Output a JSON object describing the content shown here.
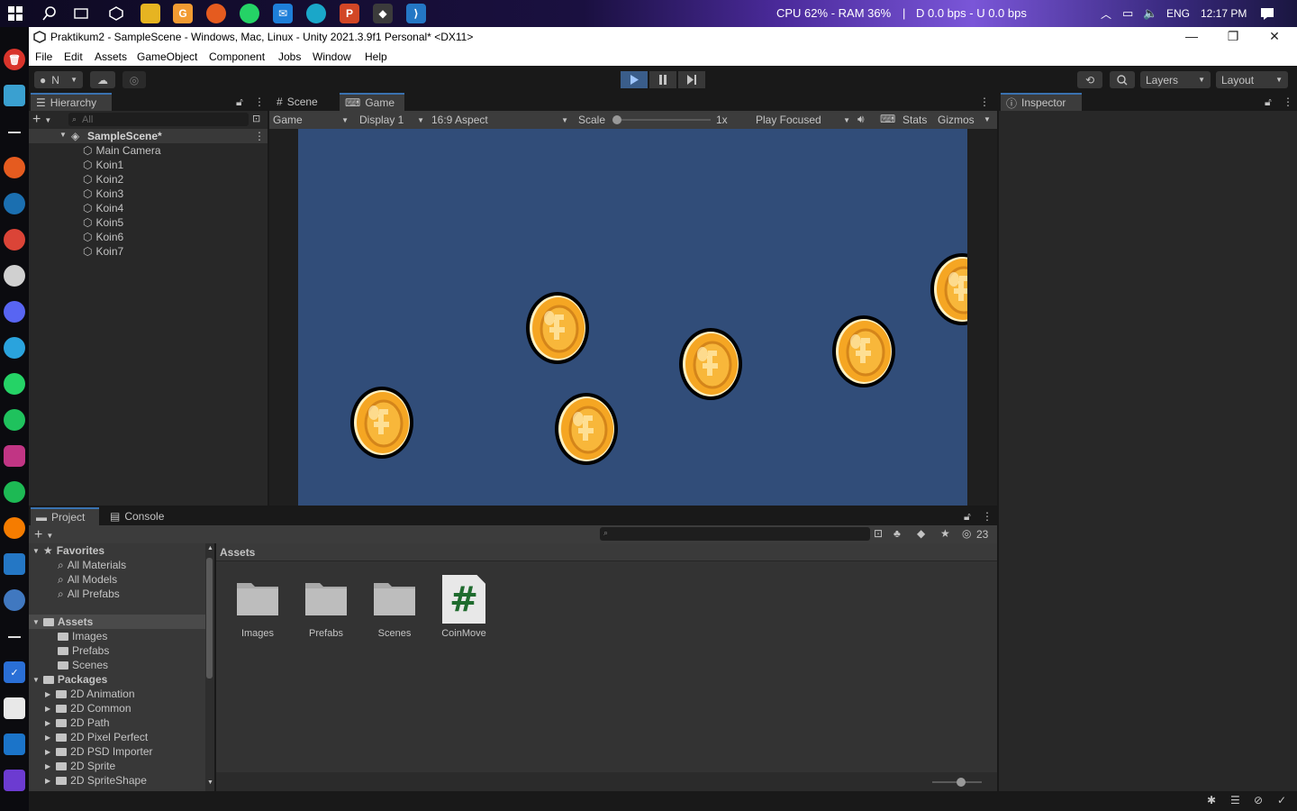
{
  "taskbar": {
    "stats": "CPU 62% - RAM 36%",
    "separator": "|",
    "network": "D 0.0 bps - U 0.0 bps",
    "lang": "ENG",
    "time": "12:17 PM"
  },
  "window": {
    "title": "Praktikum2 - SampleScene - Windows, Mac, Linux - Unity 2021.3.9f1 Personal* <DX11>",
    "minimize": "—",
    "maximize": "❐",
    "close": "✕"
  },
  "menu": [
    "File",
    "Edit",
    "Assets",
    "GameObject",
    "Component",
    "Jobs",
    "Window",
    "Help"
  ],
  "toolbar": {
    "account": "N",
    "layers": "Layers",
    "layout": "Layout"
  },
  "hierarchy": {
    "tab": "Hierarchy",
    "search_placeholder": "All",
    "scene": "SampleScene*",
    "items": [
      "Main Camera",
      "Koin1",
      "Koin2",
      "Koin3",
      "Koin4",
      "Koin5",
      "Koin6",
      "Koin7"
    ]
  },
  "sceneTabs": {
    "scene": "Scene",
    "game": "Game"
  },
  "gameBar": {
    "mode": "Game",
    "display": "Display 1",
    "aspect": "16:9 Aspect",
    "scale_label": "Scale",
    "scale_value": "1x",
    "play_mode": "Play Focused",
    "stats": "Stats",
    "gizmos": "Gizmos"
  },
  "inspector": {
    "tab": "Inspector"
  },
  "project": {
    "tab_project": "Project",
    "tab_console": "Console",
    "hidden_count": "23",
    "breadcrumb": "Assets",
    "favorites_label": "Favorites",
    "favorites": [
      "All Materials",
      "All Models",
      "All Prefabs"
    ],
    "assets_label": "Assets",
    "asset_folders": [
      "Images",
      "Prefabs",
      "Scenes"
    ],
    "packages_label": "Packages",
    "packages": [
      "2D Animation",
      "2D Common",
      "2D Path",
      "2D Pixel Perfect",
      "2D PSD Importer",
      "2D Sprite",
      "2D SpriteShape"
    ],
    "grid_items": [
      {
        "name": "Images",
        "kind": "folder"
      },
      {
        "name": "Prefabs",
        "kind": "folder"
      },
      {
        "name": "Scenes",
        "kind": "folder"
      },
      {
        "name": "CoinMove",
        "kind": "script",
        "glyph": "#"
      }
    ]
  },
  "colors": {
    "game_bg": "#314d79",
    "coin": "#f5a623",
    "accent": "#3a72b0"
  }
}
